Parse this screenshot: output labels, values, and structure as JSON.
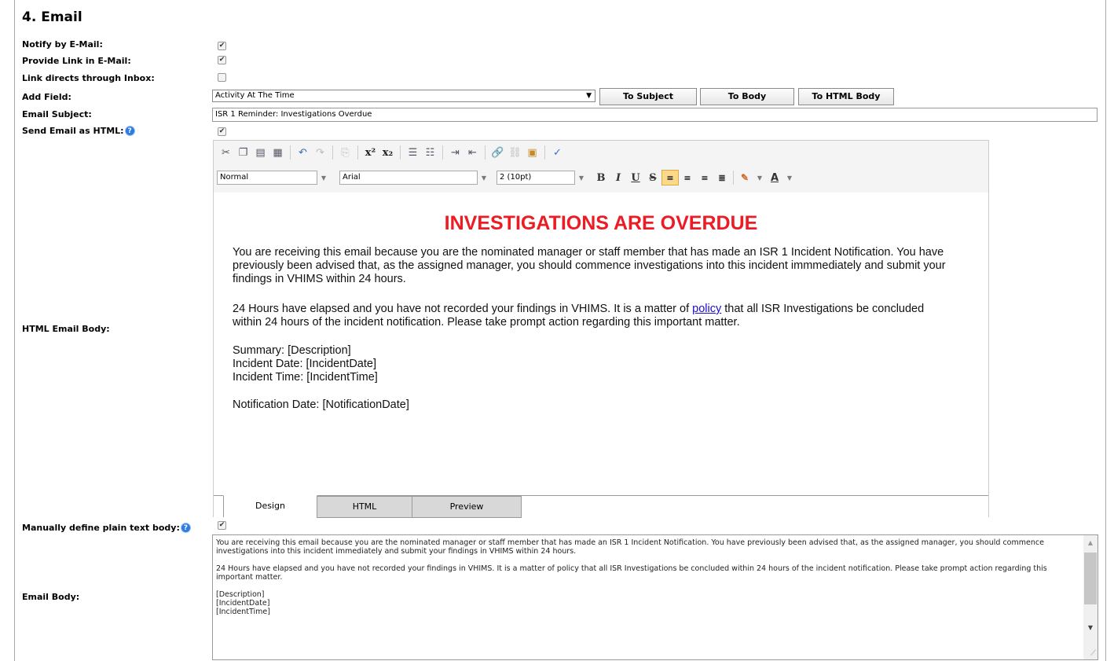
{
  "section": {
    "title": "4. Email"
  },
  "labels": {
    "notify": "Notify by E-Mail:",
    "provide_link": "Provide Link in E-Mail:",
    "link_inbox": "Link directs through Inbox:",
    "add_field": "Add Field:",
    "email_subject": "Email Subject:",
    "send_html": "Send Email as HTML:",
    "html_body": "HTML Email Body:",
    "manual_plain": "Manually define plain text body:",
    "email_body": "Email Body:"
  },
  "checkboxes": {
    "notify": true,
    "provide_link": true,
    "link_inbox": false,
    "send_html": true,
    "manual_plain": true
  },
  "check_glyph": "✔",
  "help_glyph": "?",
  "add_field": {
    "selected": "Activity At The Time",
    "buttons": {
      "to_subject": "To Subject",
      "to_body": "To Body",
      "to_html_body": "To HTML Body"
    }
  },
  "subject_value": "ISR 1 Reminder: Investigations Overdue",
  "editor": {
    "format": "Normal",
    "font": "Arial",
    "size": "2 (10pt)",
    "fmt_bold": "B",
    "fmt_italic": "I",
    "fmt_underline": "U",
    "fmt_strike": "S",
    "fmt_fontcolor": "A",
    "heading": "INVESTIGATIONS ARE OVERDUE",
    "para1": "You are receiving this email because you are the nominated manager or staff member that has made an ISR 1 Incident Notification. You have previously been advised that, as the assigned manager, you should commence investigations into this incident immmediately and submit your findings in VHIMS within 24 hours.",
    "para2_pre": "24 Hours have elapsed and you have not recorded your findings in VHIMS. It is a matter of ",
    "para2_link": "policy",
    "para2_post": " that all ISR Investigations be concluded within 24 hours of the incident notification. Please take prompt action regarding this important matter.",
    "summary": "Summary: [Description]",
    "incident_date": "Incident Date: [IncidentDate]",
    "incident_time": "Incident Time: [IncidentTime]",
    "notification_date": "Notification Date: [NotificationDate]",
    "tabs": {
      "design": "Design",
      "html": "HTML",
      "preview": "Preview"
    }
  },
  "plain_body": {
    "line1": "You are receiving this email because you are the nominated manager or staff member that has made an ISR 1 Incident Notification. You have previously been advised that, as the assigned manager, you should commence investigations into this incident immediately and submit your findings in VHIMS within 24 hours.",
    "line2": "24 Hours have elapsed and you have not recorded your findings in VHIMS. It is a matter of policy that all ISR Investigations be concluded within 24 hours of the incident notification. Please take prompt action regarding this important matter.",
    "line3": "[Description]",
    "line4": "[IncidentDate]",
    "line5": "[IncidentTime]"
  }
}
